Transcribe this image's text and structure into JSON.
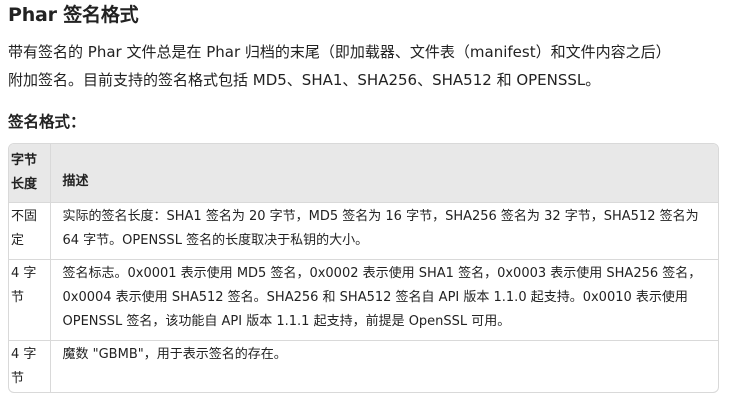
{
  "heading": "Phar 签名格式",
  "intro": {
    "line1": "带有签名的 Phar 文件总是在 Phar 归档的末尾（即加载器、文件表（manifest）和文件内容之后）",
    "line2": "附加签名。目前支持的签名格式包括 MD5、SHA1、SHA256、SHA512 和 OPENSSL。"
  },
  "subheading": "签名格式：",
  "table": {
    "headers": {
      "length_line1": "字节",
      "length_line2": "长度",
      "desc": "描述"
    },
    "rows": [
      {
        "length_line1": "不固",
        "length_line2": "定",
        "desc": "实际的签名长度：SHA1 签名为 20 字节，MD5 签名为 16 字节，SHA256 签名为 32 字节，SHA512 签名为 64 字节。OPENSSL 签名的长度取决于私钥的大小。"
      },
      {
        "length_line1": "4 字",
        "length_line2": "节",
        "desc": "签名标志。0x0001 表示使用 MD5 签名，0x0002 表示使用 SHA1 签名，0x0003 表示使用 SHA256 签名，0x0004 表示使用 SHA512 签名。SHA256 和 SHA512 签名自 API 版本 1.1.0 起支持。0x0010 表示使用 OPENSSL 签名，该功能自 API 版本 1.1.1 起支持，前提是 OpenSSL 可用。"
      },
      {
        "length_line1": "4 字",
        "length_line2": "节",
        "desc": "魔数 \"GBMB\"，用于表示签名的存在。"
      }
    ]
  }
}
